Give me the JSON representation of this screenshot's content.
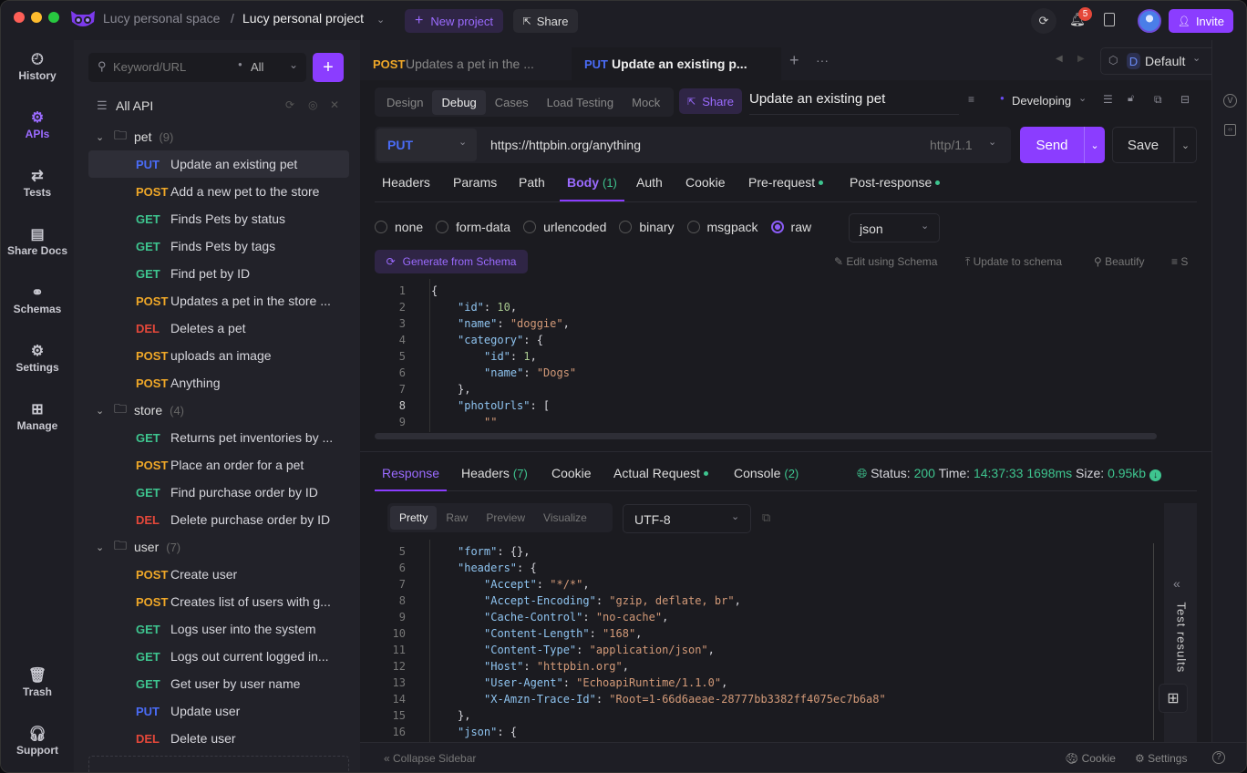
{
  "colors": {
    "accent": "#8b3dff",
    "get": "#3ec58f",
    "post": "#f0a828",
    "put": "#4a6cf7",
    "del": "#e5483a"
  },
  "titlebar": {
    "workspace": "Lucy personal space",
    "separator": "/",
    "project": "Lucy personal project",
    "new_project": "New project",
    "share": "Share",
    "notifications": "5",
    "invite": "Invite"
  },
  "rail": {
    "items": [
      {
        "label": "History",
        "icon": "history-icon"
      },
      {
        "label": "APIs",
        "icon": "apis-icon"
      },
      {
        "label": "Tests",
        "icon": "tests-icon"
      },
      {
        "label": "Share Docs",
        "icon": "share-docs-icon"
      },
      {
        "label": "Schemas",
        "icon": "schemas-icon"
      },
      {
        "label": "Settings",
        "icon": "settings-icon"
      },
      {
        "label": "Manage",
        "icon": "manage-icon"
      },
      {
        "label": "Trash",
        "icon": "trash-icon"
      },
      {
        "label": "Support",
        "icon": "support-icon"
      }
    ]
  },
  "sidebar": {
    "search_placeholder": "Keyword/URL",
    "filter": "All",
    "all_api": "All API",
    "tree": [
      {
        "type": "folder",
        "name": "pet",
        "count": "(9)"
      },
      {
        "method": "PUT",
        "name": "Update an existing pet",
        "selected": true
      },
      {
        "method": "POST",
        "name": "Add a new pet to the store"
      },
      {
        "method": "GET",
        "name": "Finds Pets by status"
      },
      {
        "method": "GET",
        "name": "Finds Pets by tags"
      },
      {
        "method": "GET",
        "name": "Find pet by ID"
      },
      {
        "method": "POST",
        "name": "Updates a pet in the store ..."
      },
      {
        "method": "DEL",
        "name": "Deletes a pet"
      },
      {
        "method": "POST",
        "name": "uploads an image"
      },
      {
        "method": "POST",
        "name": "Anything"
      },
      {
        "type": "folder",
        "name": "store",
        "count": "(4)"
      },
      {
        "method": "GET",
        "name": "Returns pet inventories by ..."
      },
      {
        "method": "POST",
        "name": "Place an order for a pet"
      },
      {
        "method": "GET",
        "name": "Find purchase order by ID"
      },
      {
        "method": "DEL",
        "name": "Delete purchase order by ID"
      },
      {
        "type": "folder",
        "name": "user",
        "count": "(7)"
      },
      {
        "method": "POST",
        "name": "Create user"
      },
      {
        "method": "POST",
        "name": "Creates list of users with g..."
      },
      {
        "method": "GET",
        "name": "Logs user into the system"
      },
      {
        "method": "GET",
        "name": "Logs out current logged in..."
      },
      {
        "method": "GET",
        "name": "Get user by user name"
      },
      {
        "method": "PUT",
        "name": "Update user"
      },
      {
        "method": "DEL",
        "name": "Delete user"
      }
    ]
  },
  "tabs": [
    {
      "method": "POST",
      "title": "Updates a pet in the ..."
    },
    {
      "method": "PUT",
      "title": "Update an existing p...",
      "active": true
    }
  ],
  "env": {
    "badge": "D",
    "name": "Default"
  },
  "modes": [
    "Design",
    "Debug",
    "Cases",
    "Load Testing",
    "Mock"
  ],
  "active_mode": "Debug",
  "api_share": "Share",
  "api_name": "Update an existing pet",
  "api_status": "Developing",
  "request": {
    "method": "PUT",
    "url": "https://httpbin.org/anything",
    "protocol": "http/1.1",
    "send": "Send",
    "save": "Save"
  },
  "req_tabs": [
    {
      "label": "Headers"
    },
    {
      "label": "Params"
    },
    {
      "label": "Path"
    },
    {
      "label": "Body",
      "count": "(1)",
      "active": true
    },
    {
      "label": "Auth"
    },
    {
      "label": "Cookie"
    },
    {
      "label": "Pre-request",
      "dot": true
    },
    {
      "label": "Post-response",
      "dot": true
    }
  ],
  "body_types": [
    {
      "label": "none"
    },
    {
      "label": "form-data"
    },
    {
      "label": "urlencoded"
    },
    {
      "label": "binary"
    },
    {
      "label": "msgpack"
    },
    {
      "label": "raw",
      "selected": true
    }
  ],
  "raw_format": "json",
  "body_actions": {
    "generate": "Generate from Schema",
    "edit": "Edit using Schema",
    "update": "Update to schema",
    "beautify": "Beautify",
    "more": "S"
  },
  "body_code": [
    {
      "n": "1",
      "i": 0,
      "t": [
        [
          "p",
          "{"
        ]
      ]
    },
    {
      "n": "2",
      "i": 1,
      "t": [
        [
          "k",
          "\"id\""
        ],
        [
          "p",
          ": "
        ],
        [
          "n",
          "10"
        ],
        [
          "p",
          ","
        ]
      ]
    },
    {
      "n": "3",
      "i": 1,
      "t": [
        [
          "k",
          "\"name\""
        ],
        [
          "p",
          ": "
        ],
        [
          "s",
          "\"doggie\""
        ],
        [
          "p",
          ","
        ]
      ]
    },
    {
      "n": "4",
      "i": 1,
      "t": [
        [
          "k",
          "\"category\""
        ],
        [
          "p",
          ": {"
        ]
      ]
    },
    {
      "n": "5",
      "i": 2,
      "t": [
        [
          "k",
          "\"id\""
        ],
        [
          "p",
          ": "
        ],
        [
          "n",
          "1"
        ],
        [
          "p",
          ","
        ]
      ]
    },
    {
      "n": "6",
      "i": 2,
      "t": [
        [
          "k",
          "\"name\""
        ],
        [
          "p",
          ": "
        ],
        [
          "s",
          "\"Dogs\""
        ]
      ]
    },
    {
      "n": "7",
      "i": 1,
      "t": [
        [
          "p",
          "},"
        ]
      ]
    },
    {
      "n": "8",
      "i": 1,
      "t": [
        [
          "k",
          "\"photoUrls\""
        ],
        [
          "p",
          ": ["
        ]
      ]
    },
    {
      "n": "9",
      "i": 2,
      "t": [
        [
          "s",
          "\"\""
        ]
      ]
    }
  ],
  "resp_tabs": [
    {
      "label": "Response",
      "active": true
    },
    {
      "label": "Headers",
      "count": "(7)"
    },
    {
      "label": "Cookie"
    },
    {
      "label": "Actual Request",
      "dot": true
    },
    {
      "label": "Console",
      "count": "(2)"
    }
  ],
  "resp_meta": {
    "status_label": "Status:",
    "status": "200",
    "time_label": "Time:",
    "time": "14:37:33",
    "duration": "1698ms",
    "size_label": "Size:",
    "size": "0.95kb"
  },
  "view_modes": [
    "Pretty",
    "Raw",
    "Preview",
    "Visualize"
  ],
  "encoding": "UTF-8",
  "resp_code": [
    {
      "n": "5",
      "i": 1,
      "t": [
        [
          "k",
          "\"form\""
        ],
        [
          "p",
          ": {},"
        ]
      ]
    },
    {
      "n": "6",
      "i": 1,
      "t": [
        [
          "k",
          "\"headers\""
        ],
        [
          "p",
          ": {"
        ]
      ]
    },
    {
      "n": "7",
      "i": 2,
      "t": [
        [
          "k",
          "\"Accept\""
        ],
        [
          "p",
          ": "
        ],
        [
          "s",
          "\"*/*\""
        ],
        [
          "p",
          ","
        ]
      ]
    },
    {
      "n": "8",
      "i": 2,
      "t": [
        [
          "k",
          "\"Accept-Encoding\""
        ],
        [
          "p",
          ": "
        ],
        [
          "s",
          "\"gzip, deflate, br\""
        ],
        [
          "p",
          ","
        ]
      ]
    },
    {
      "n": "9",
      "i": 2,
      "t": [
        [
          "k",
          "\"Cache-Control\""
        ],
        [
          "p",
          ": "
        ],
        [
          "s",
          "\"no-cache\""
        ],
        [
          "p",
          ","
        ]
      ]
    },
    {
      "n": "10",
      "i": 2,
      "t": [
        [
          "k",
          "\"Content-Length\""
        ],
        [
          "p",
          ": "
        ],
        [
          "s",
          "\"168\""
        ],
        [
          "p",
          ","
        ]
      ]
    },
    {
      "n": "11",
      "i": 2,
      "t": [
        [
          "k",
          "\"Content-Type\""
        ],
        [
          "p",
          ": "
        ],
        [
          "s",
          "\"application/json\""
        ],
        [
          "p",
          ","
        ]
      ]
    },
    {
      "n": "12",
      "i": 2,
      "t": [
        [
          "k",
          "\"Host\""
        ],
        [
          "p",
          ": "
        ],
        [
          "s",
          "\"httpbin.org\""
        ],
        [
          "p",
          ","
        ]
      ]
    },
    {
      "n": "13",
      "i": 2,
      "t": [
        [
          "k",
          "\"User-Agent\""
        ],
        [
          "p",
          ": "
        ],
        [
          "s",
          "\"EchoapiRuntime/1.1.0\""
        ],
        [
          "p",
          ","
        ]
      ]
    },
    {
      "n": "14",
      "i": 2,
      "t": [
        [
          "k",
          "\"X-Amzn-Trace-Id\""
        ],
        [
          "p",
          ": "
        ],
        [
          "s",
          "\"Root=1-66d6aeae-28777bb3382ff4075ec7b6a8\""
        ]
      ]
    },
    {
      "n": "15",
      "i": 1,
      "t": [
        [
          "p",
          "},"
        ]
      ]
    },
    {
      "n": "16",
      "i": 1,
      "t": [
        [
          "k",
          "\"json\""
        ],
        [
          "p",
          ": {"
        ]
      ]
    }
  ],
  "test_results": "Test results",
  "footer": {
    "collapse": "Collapse Sidebar",
    "cookie": "Cookie",
    "settings": "Settings"
  }
}
